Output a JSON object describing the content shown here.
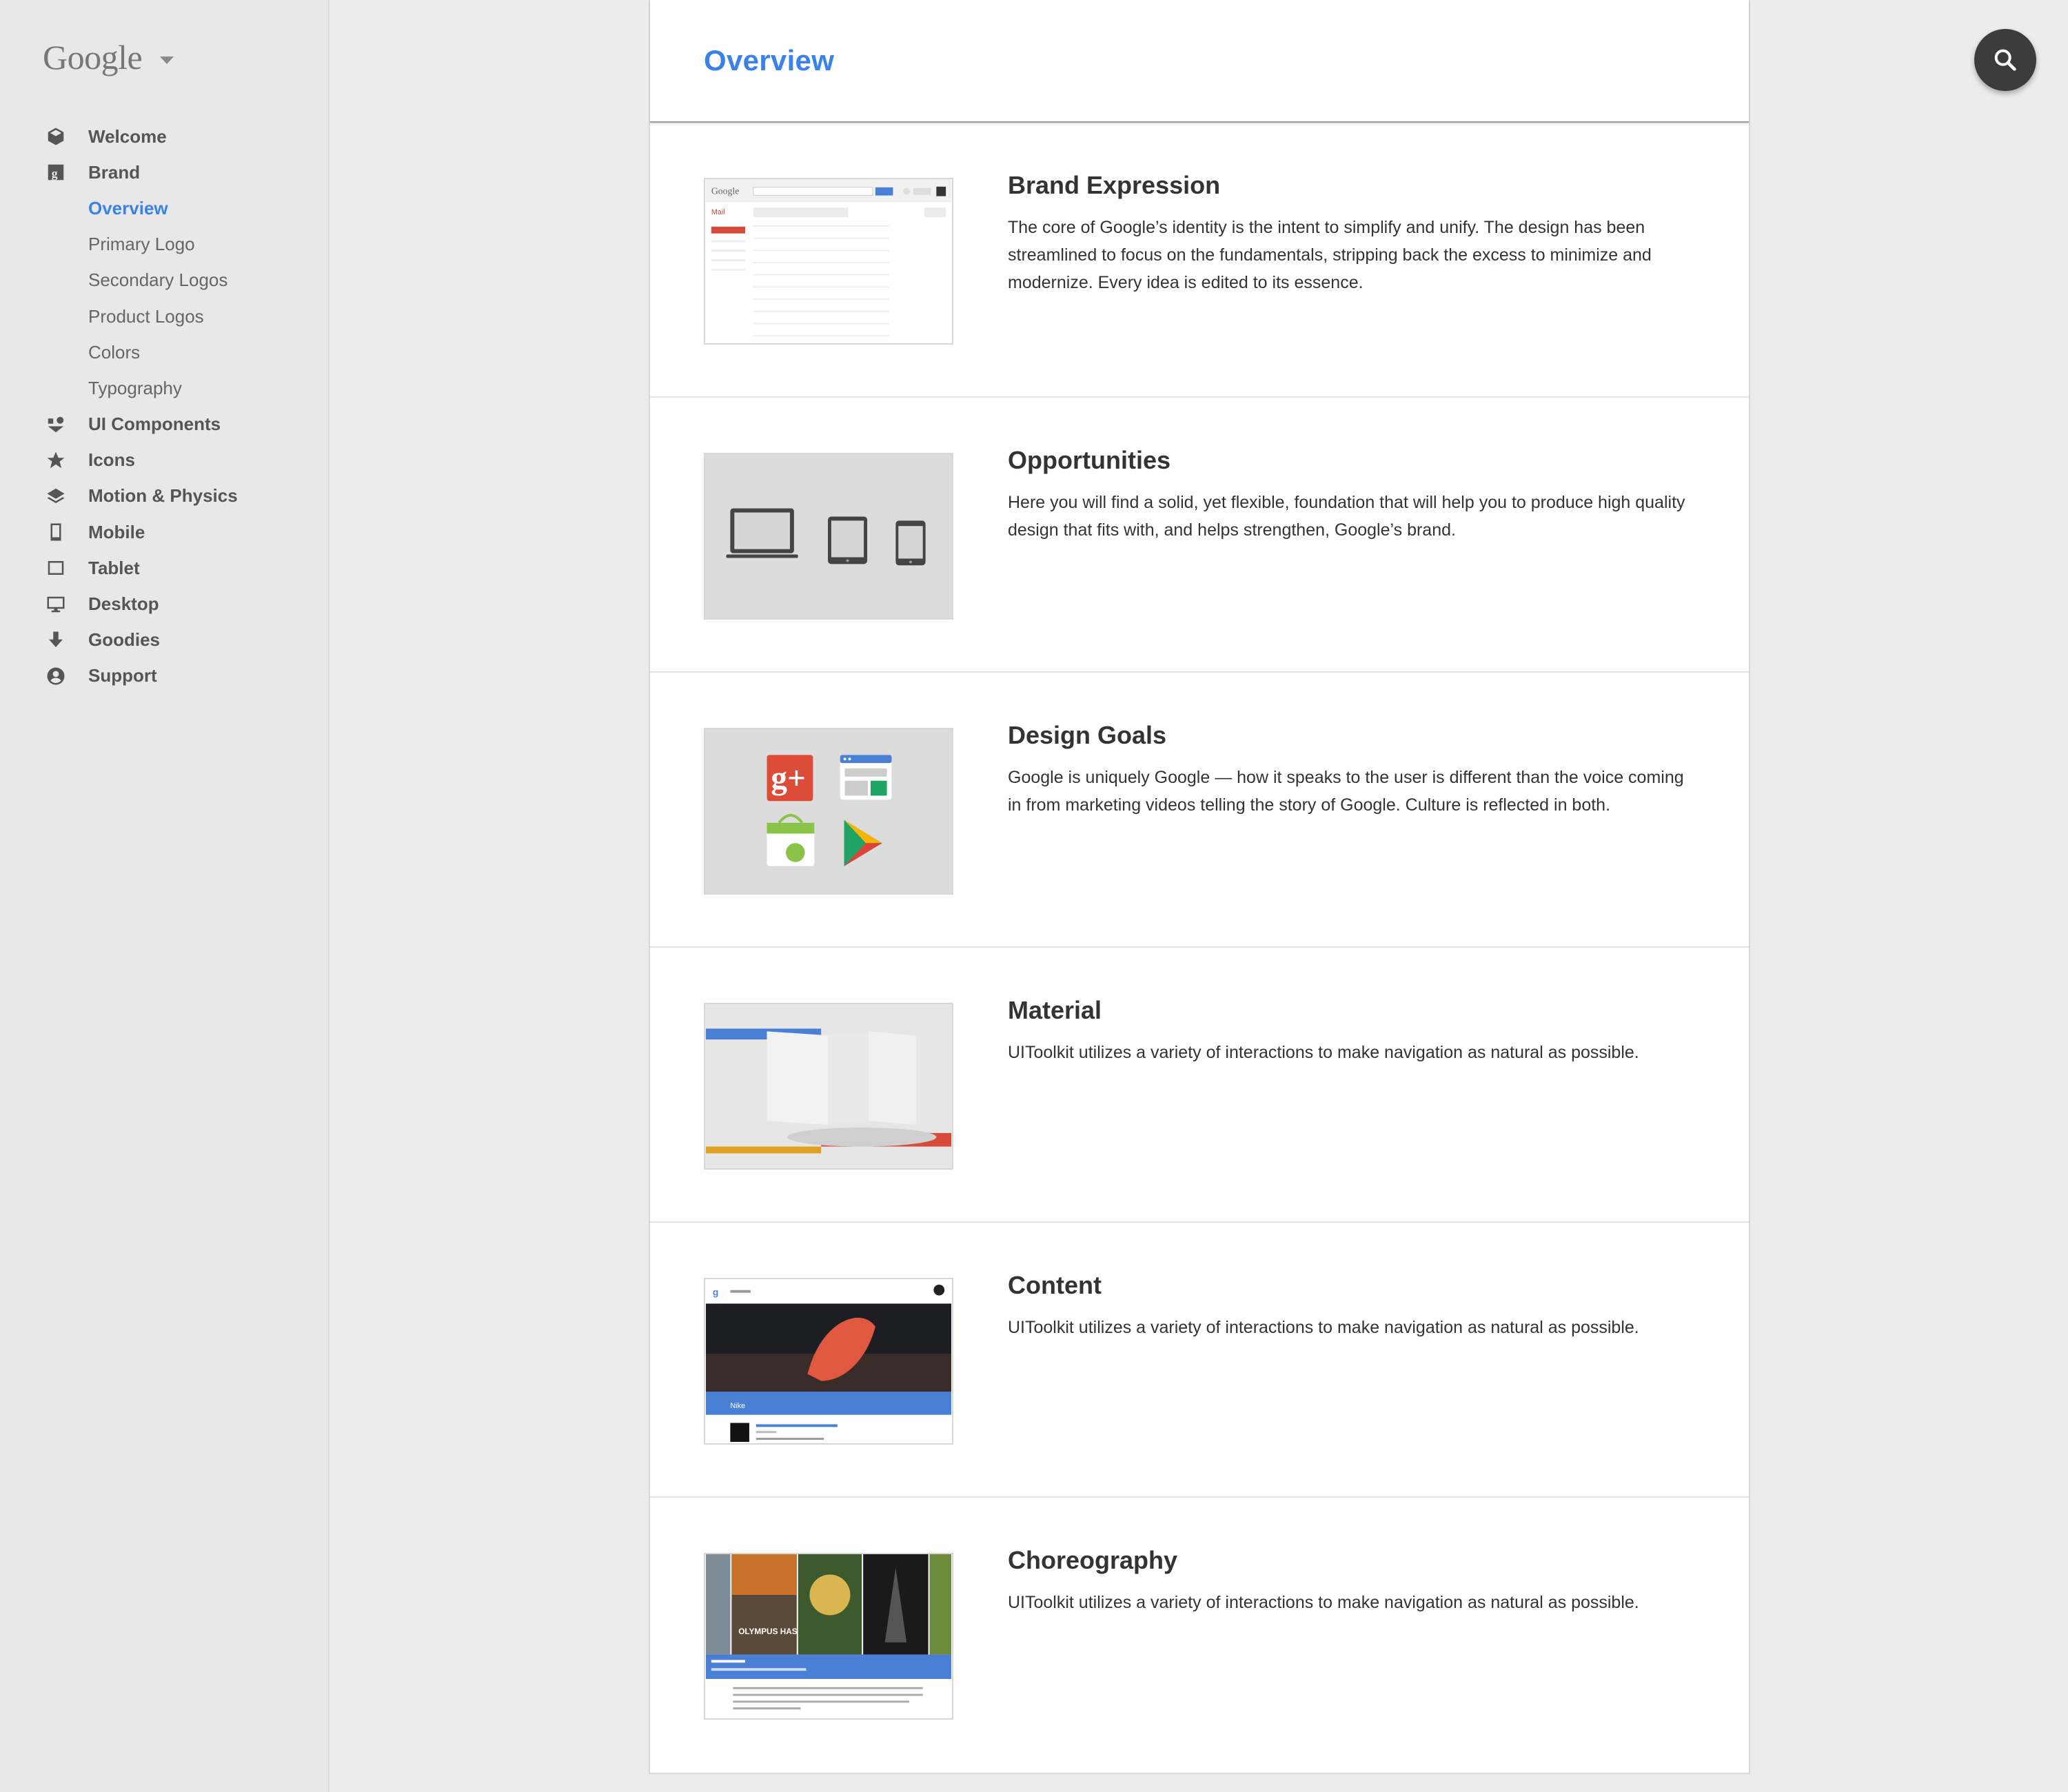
{
  "sidebar": {
    "logo": "Google",
    "items": [
      {
        "label": "Welcome",
        "icon": "cube-icon"
      },
      {
        "label": "Brand",
        "icon": "brand-g-icon"
      },
      {
        "label": "Overview"
      },
      {
        "label": "Primary Logo"
      },
      {
        "label": "Secondary Logos"
      },
      {
        "label": "Product Logos"
      },
      {
        "label": "Colors"
      },
      {
        "label": "Typography"
      },
      {
        "label": "UI Components",
        "icon": "components-icon"
      },
      {
        "label": "Icons",
        "icon": "star-icon"
      },
      {
        "label": "Motion & Physics",
        "icon": "layers-icon"
      },
      {
        "label": "Mobile",
        "icon": "phone-icon"
      },
      {
        "label": "Tablet",
        "icon": "tablet-icon"
      },
      {
        "label": "Desktop",
        "icon": "desktop-icon"
      },
      {
        "label": "Goodies",
        "icon": "download-arrow-icon"
      },
      {
        "label": "Support",
        "icon": "account-circle-icon"
      }
    ]
  },
  "main": {
    "title": "Overview",
    "sections": [
      {
        "title": "Brand Expression",
        "body": "The core of Google’s identity is the intent to simplify and unify. The design has been streamlined to focus on the fundamentals, stripping back the excess to minimize and modernize. Every idea is edited to its essence."
      },
      {
        "title": "Opportunities",
        "body": "Here you will find a solid, yet flexible, foundation that will help you to produce high quality design that fits with, and helps strengthen, Google’s brand."
      },
      {
        "title": "Design Goals",
        "body": "Google is uniquely Google — how it speaks to the user is different than the voice coming in from marketing videos telling the story of Google. Culture is reflected in both."
      },
      {
        "title": "Material",
        "body": "UIToolkit utilizes a variety of interactions to make navigation as natural as possible."
      },
      {
        "title": "Content",
        "body": "UIToolkit utilizes a variety of interactions to make navigation as natural as possible."
      },
      {
        "title": "Choreography",
        "body": "UIToolkit utilizes a variety of interactions to make navigation as natural as possible."
      }
    ]
  },
  "thumbs": {
    "mail_logo": "Google",
    "mail_label": "Mail",
    "nike_label": "Nike",
    "olympus_title": "OLYMPUS HAS FALLEN"
  },
  "colors": {
    "accent": "#3b82e8",
    "gplus_red": "#dd4b39",
    "android_green": "#8bc34a",
    "material_blue": "#4a7fd6",
    "material_red": "#d84a3a",
    "material_yellow": "#e0a123"
  }
}
